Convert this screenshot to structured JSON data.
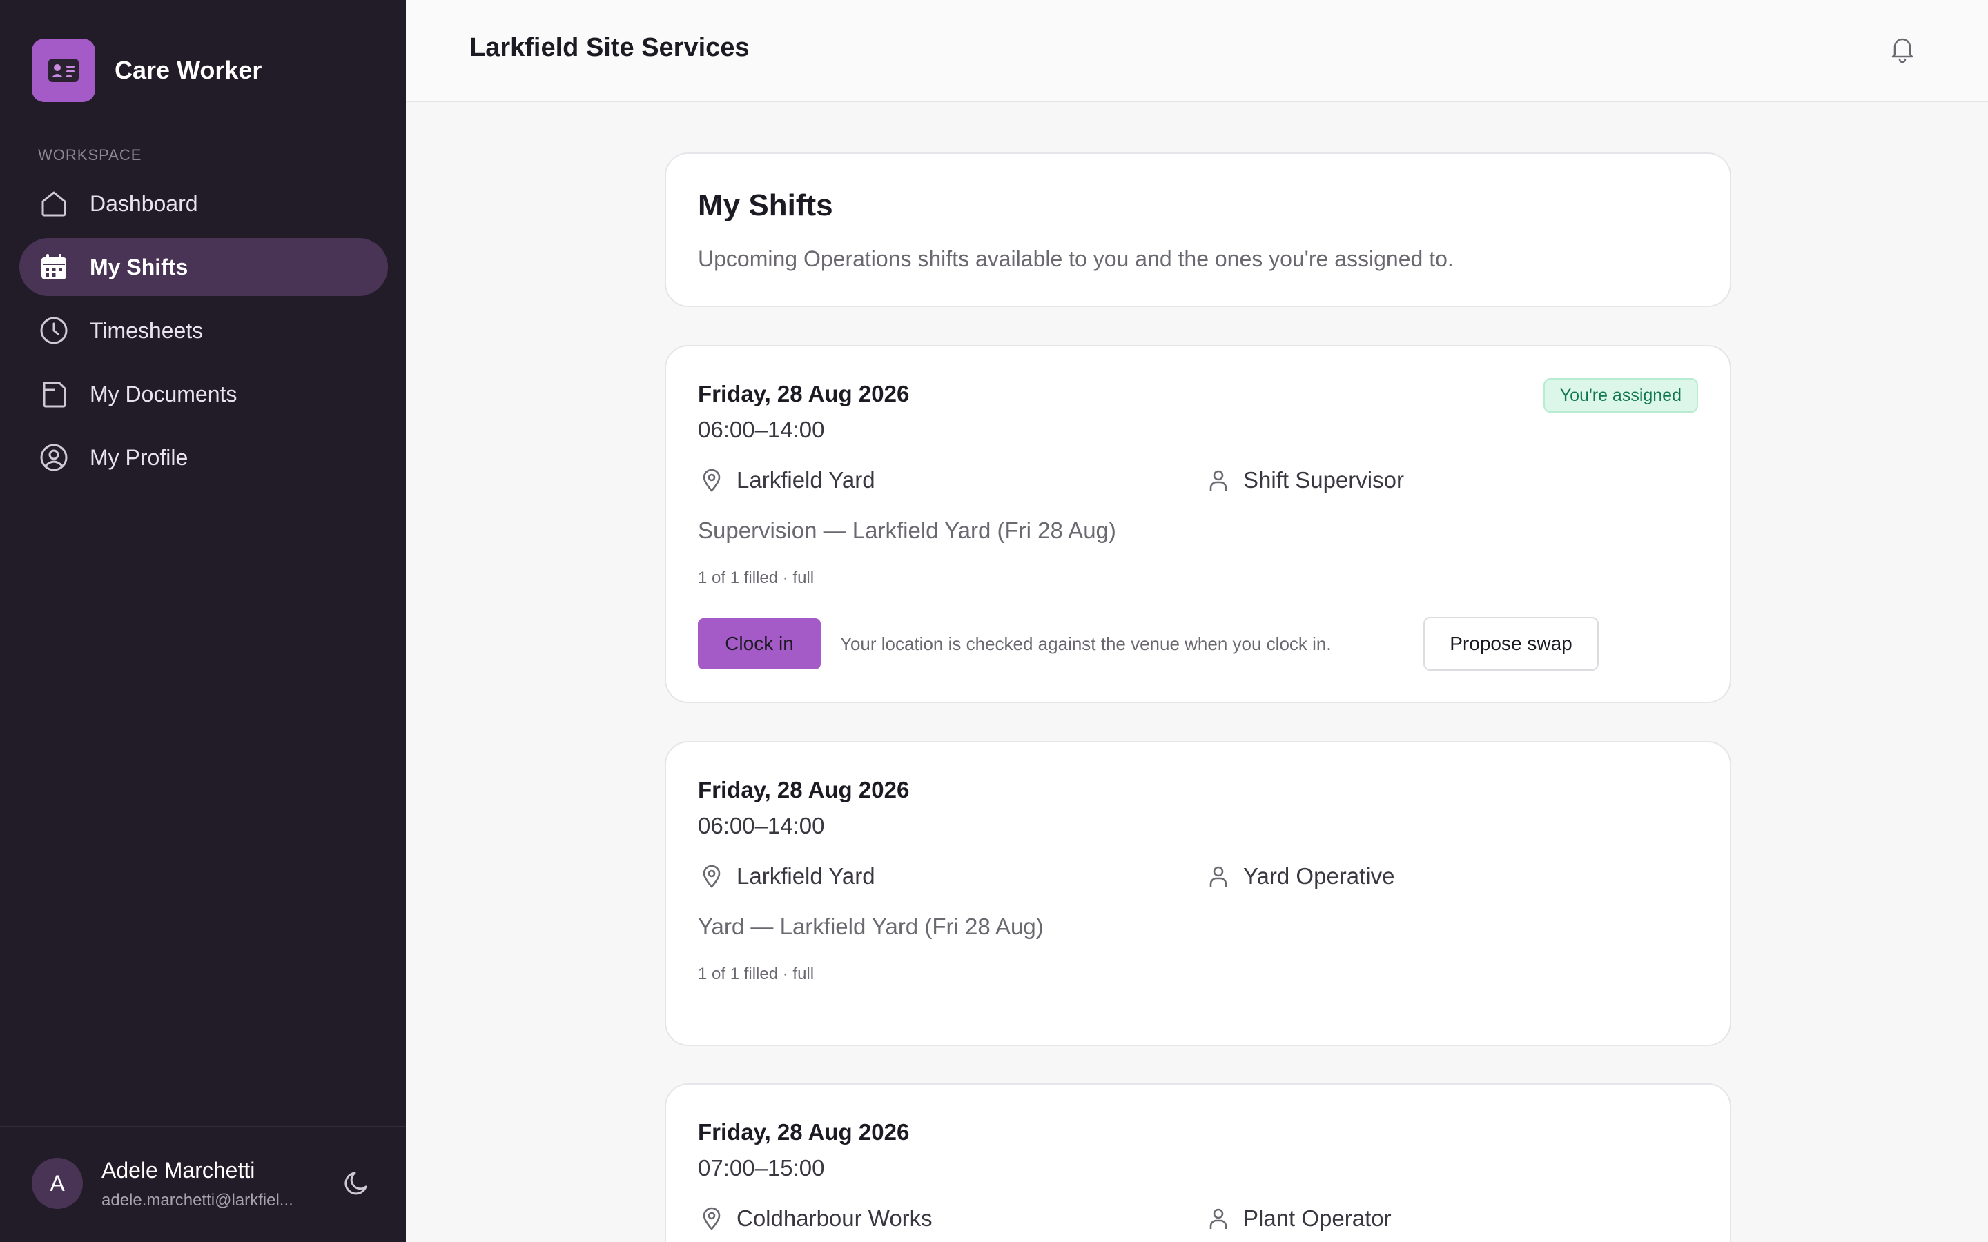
{
  "app": {
    "brand_name": "Care Worker",
    "org_name": "Larkfield Site Services"
  },
  "sidebar": {
    "section_label": "WORKSPACE",
    "items": [
      {
        "label": "Dashboard",
        "icon": "home-icon",
        "active": false
      },
      {
        "label": "My Shifts",
        "icon": "calendar-icon",
        "active": true
      },
      {
        "label": "Timesheets",
        "icon": "clock-icon",
        "active": false
      },
      {
        "label": "My Documents",
        "icon": "document-icon",
        "active": false
      },
      {
        "label": "My Profile",
        "icon": "user-circle-icon",
        "active": false
      }
    ],
    "user": {
      "initial": "A",
      "name": "Adele Marchetti",
      "email": "adele.marchetti@larkfiel..."
    }
  },
  "page": {
    "title": "My Shifts",
    "subtitle": "Upcoming Operations shifts available to you and the ones you're assigned to."
  },
  "shifts": [
    {
      "date": "Friday, 28 Aug 2026",
      "time": "06:00–14:00",
      "location": "Larkfield Yard",
      "role": "Shift Supervisor",
      "description": "Supervision — Larkfield Yard (Fri 28 Aug)",
      "fill_status": "1 of 1 filled · full",
      "badge": "You're assigned",
      "clock_in_label": "Clock in",
      "hint": "Your location is checked against the venue when you clock in.",
      "swap_label": "Propose swap"
    },
    {
      "date": "Friday, 28 Aug 2026",
      "time": "06:00–14:00",
      "location": "Larkfield Yard",
      "role": "Yard Operative",
      "description": "Yard — Larkfield Yard (Fri 28 Aug)",
      "fill_status": "1 of 1 filled · full"
    },
    {
      "date": "Friday, 28 Aug 2026",
      "time": "07:00–15:00",
      "location": "Coldharbour Works",
      "role": "Plant Operator"
    }
  ],
  "colors": {
    "sidebar_bg": "#221c29",
    "accent": "#a55bc7",
    "active_nav_bg": "#4a3456",
    "assigned_badge_bg": "#dcf6e9",
    "assigned_badge_text": "#12784f"
  }
}
